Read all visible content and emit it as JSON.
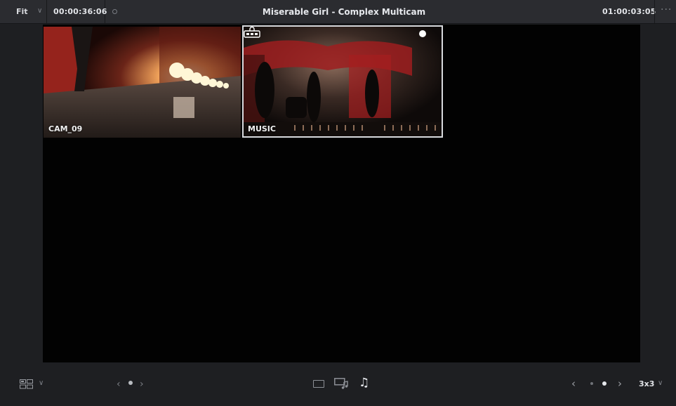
{
  "topbar": {
    "zoom_value": "Fit",
    "zoom_chevron": "∨",
    "source_timecode": "00:00:36:06",
    "title": "Miserable Girl - Complex Multicam",
    "record_timecode": "01:00:03:05",
    "more_label": "···"
  },
  "viewer": {
    "angles": [
      {
        "label": "CAM_09"
      },
      {
        "label": "MUSIC"
      }
    ]
  },
  "bottombar": {
    "layout_chevron": "∨",
    "page_prev": "‹",
    "page_next": "›",
    "bank_prev": "‹",
    "bank_next": "›",
    "grid_size": "3x3",
    "grid_chevron": "∨",
    "audio_mode_icon": "♫"
  },
  "icons": {
    "layout": "layout-grid-icon",
    "video_mode": "video-switch-icon",
    "av_mode": "audio-video-switch-icon",
    "audio_mode": "audio-switch-icon",
    "audio_lock": "audio-lock-icon"
  },
  "colors": {
    "panel": "#2b2c30",
    "viewer": "#020202",
    "selected_border": "#d8dade"
  }
}
